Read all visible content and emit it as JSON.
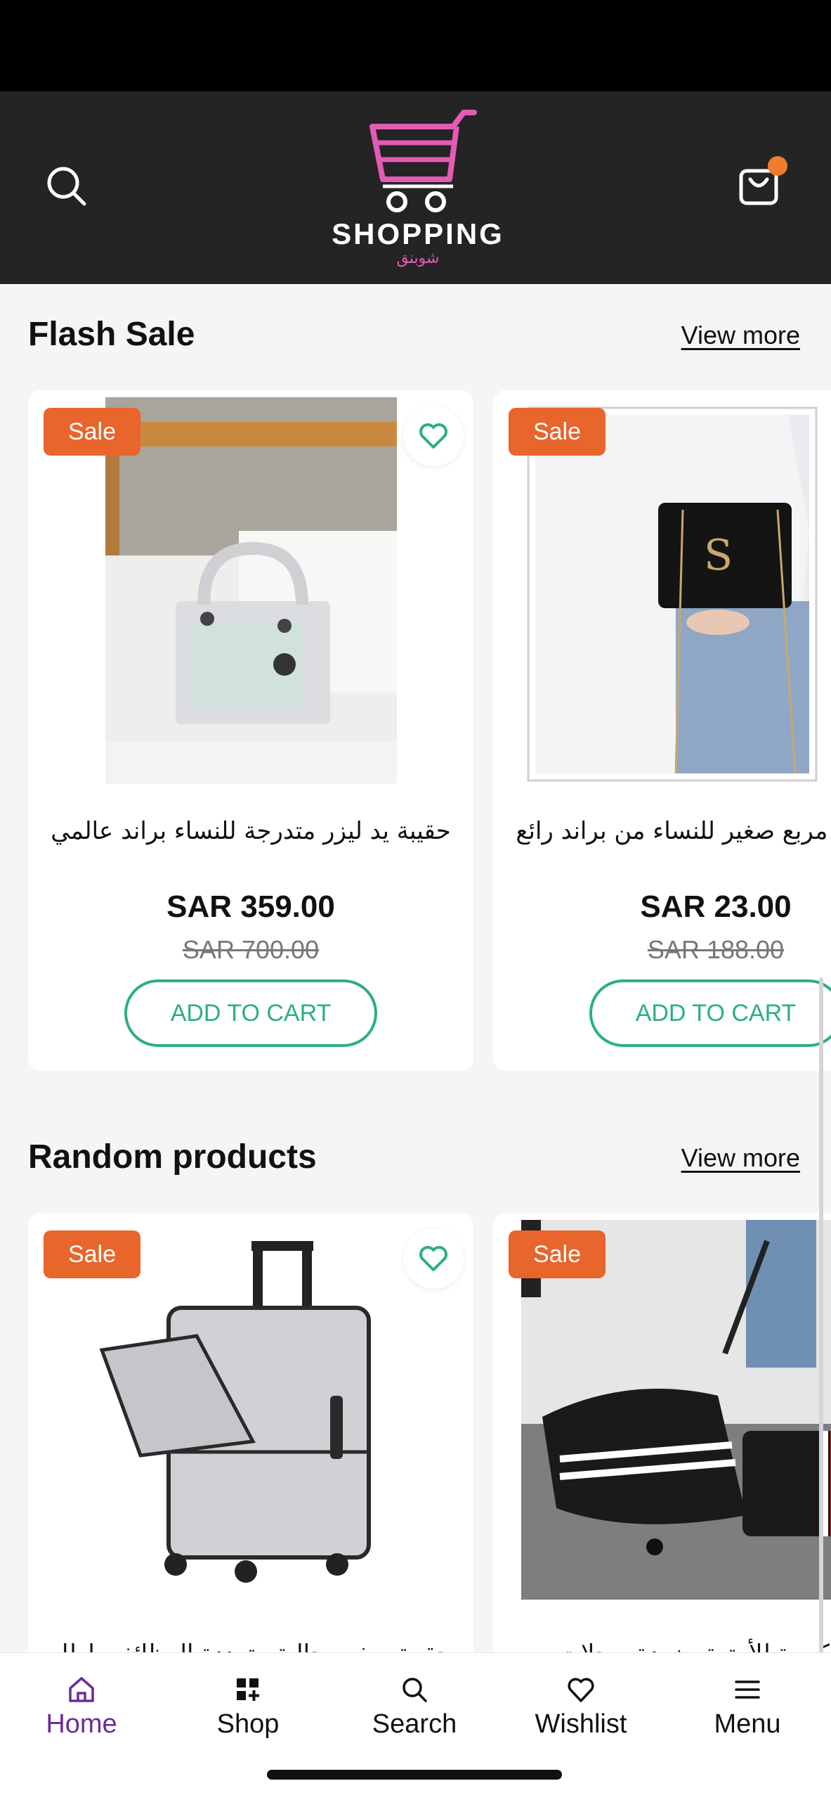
{
  "header": {
    "brand": "SHOPPING",
    "brand_ar": "شوبنق",
    "cart_badge_color": "#f07a2e"
  },
  "flash_sale": {
    "title": "Flash Sale",
    "view_more": "View more",
    "products": [
      {
        "badge": "Sale",
        "name": "حقيبة يد ليزر متدرجة للنساء براند عالمي",
        "price": "SAR 359.00",
        "old_price": "SAR 700.00",
        "cta": "ADD TO CART",
        "image": "silver-handbag-photo",
        "wishlist_icon": "heart-icon"
      },
      {
        "badge": "Sale",
        "name": "وسبودي مربع صغير للنساء من براند رائع",
        "price": "SAR 23.00",
        "old_price": "SAR 188.00",
        "cta": "ADD TO CART",
        "image": "black-crossbody-bag-photo"
      }
    ]
  },
  "random_products": {
    "title": "Random products",
    "view_more": "View more",
    "products": [
      {
        "badge": "Sale",
        "name": "حقيبة سفر رحالية متعددة الوظائف باطار",
        "image": "silver-suitcase-photo",
        "wishlist_icon": "heart-icon"
      },
      {
        "badge": "Sale",
        "name": "لات كبيرة للأمتعة مزودة بعجلات",
        "image": "black-rolling-duffel-photo"
      }
    ]
  },
  "bottom_nav": {
    "items": [
      {
        "label": "Home",
        "icon": "home-icon",
        "active": true
      },
      {
        "label": "Shop",
        "icon": "grid-icon"
      },
      {
        "label": "Search",
        "icon": "search-icon"
      },
      {
        "label": "Wishlist",
        "icon": "heart-icon"
      },
      {
        "label": "Menu",
        "icon": "menu-icon"
      }
    ]
  },
  "colors": {
    "accent_green": "#2bb07f",
    "sale_orange": "#e8652c",
    "active_nav": "#6a2c9a",
    "header_bg": "#242424"
  }
}
